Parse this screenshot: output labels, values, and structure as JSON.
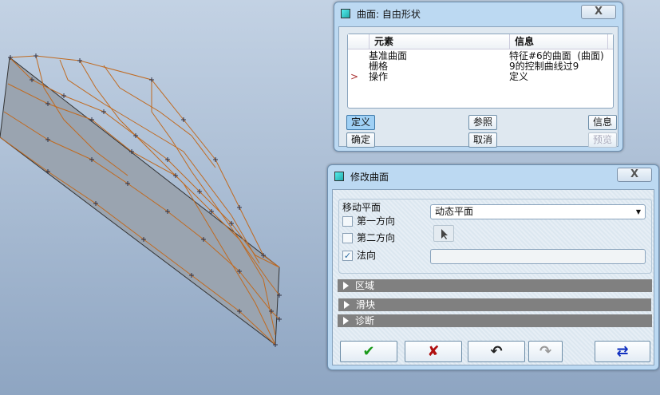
{
  "dialog1": {
    "title": "曲面: 自由形状",
    "close": "X",
    "columns": [
      "元素",
      "信息"
    ],
    "rows": [
      {
        "marker": "",
        "element": "基准曲面",
        "info": "特征#6的曲面  (曲面)"
      },
      {
        "marker": "",
        "element": "栅格",
        "info": "9的控制曲线过9"
      },
      {
        "marker": ">",
        "element": "操作",
        "info": "定义"
      }
    ],
    "buttons": {
      "define": "定义",
      "ref": "参照",
      "info": "信息",
      "ok": "确定",
      "cancel": "取消",
      "preview": "预览"
    }
  },
  "dialog2": {
    "title": "修改曲面",
    "close": "X",
    "group_label": "移动平面",
    "options": [
      {
        "label": "第一方向",
        "checked": false
      },
      {
        "label": "第二方向",
        "checked": false
      },
      {
        "label": "法向",
        "checked": true
      }
    ],
    "plane_select": "动态平面",
    "sections": [
      "区域",
      "滑块",
      "诊断"
    ],
    "checkmark": "✔",
    "cross": "✘",
    "undo": "↶",
    "redo": "↷",
    "swap": "⇄",
    "checked_glyph": "✓"
  }
}
